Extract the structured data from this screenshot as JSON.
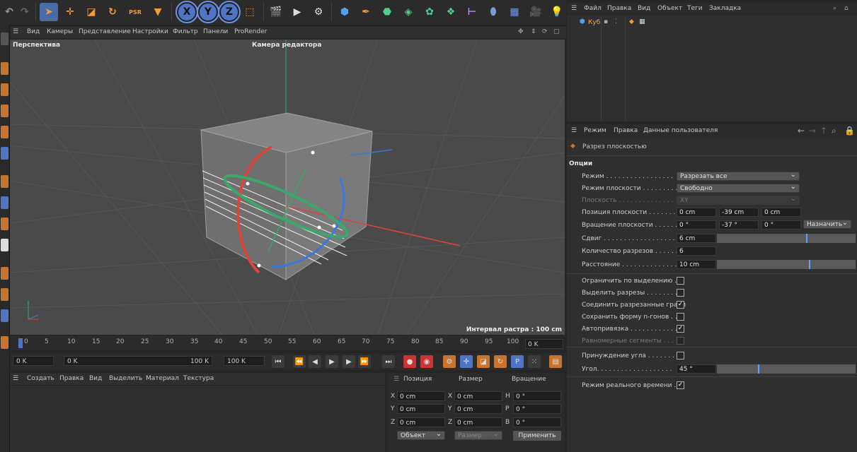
{
  "viewport": {
    "menu": [
      "Вид",
      "Камеры",
      "Представление",
      "Настройки",
      "Фильтр",
      "Панели",
      "ProRender"
    ],
    "title": "Перспектива",
    "camera": "Камера редактора",
    "grid_spacing": "Интервал растра : 100 cm"
  },
  "timeline": {
    "ticks": [
      "0",
      "5",
      "10",
      "15",
      "20",
      "25",
      "30",
      "35",
      "40",
      "45",
      "50",
      "55",
      "60",
      "65",
      "70",
      "75",
      "80",
      "85",
      "90",
      "95",
      "100"
    ],
    "current_frame": "0 K",
    "start": "0 K",
    "range_start": "0 K",
    "range_end": "100 K",
    "end": "100 K"
  },
  "material_menu": [
    "Создать",
    "Правка",
    "Вид",
    "Выделить",
    "Материал",
    "Текстура"
  ],
  "coordinates": {
    "headers": [
      "Позиция",
      "Размер",
      "Вращение"
    ],
    "rows": [
      {
        "axis": "X",
        "pos": "0 cm",
        "saxis": "X",
        "size": "0 cm",
        "raxis": "H",
        "rot": "0 °"
      },
      {
        "axis": "Y",
        "pos": "0 cm",
        "saxis": "Y",
        "size": "0 cm",
        "raxis": "P",
        "rot": "0 °"
      },
      {
        "axis": "Z",
        "pos": "0 cm",
        "saxis": "Z",
        "size": "0 cm",
        "raxis": "B",
        "rot": "0 °"
      }
    ],
    "mode": "Объект",
    "size_mode": "Размер",
    "apply": "Применить"
  },
  "object_menu": [
    "Файл",
    "Правка",
    "Вид",
    "Объект",
    "Теги",
    "Закладка"
  ],
  "objects": [
    {
      "name": "Куб"
    }
  ],
  "attr_menu": [
    "Режим",
    "Правка",
    "Данные пользователя"
  ],
  "attributes": {
    "tool_name": "Разрез плоскостью",
    "section": "Опции",
    "mode_label": "Режим . . . . . . . . . . . . . . . . .",
    "mode_value": "Разрезать все",
    "plane_mode_label": "Режим плоскости . . . . . . . . . .",
    "plane_mode_value": "Свободно",
    "plane_label": "Плоскость . . . . . . . . . . . . . .",
    "plane_value": "XY",
    "plane_pos_label": "Позиция плоскости . . . . . . . . .",
    "plane_pos": [
      "0 cm",
      "-39 cm",
      "0 cm"
    ],
    "plane_rot_label": "Вращение плоскости . . . . . . . .",
    "plane_rot": [
      "0 °",
      "-37 °",
      "0 °"
    ],
    "assign": "Назначить",
    "offset_label": "Сдвиг . . . . . . . . . . . . . . . . . .",
    "offset_value": "6 cm",
    "cuts_label": "Количество разрезов . . . . . . .",
    "cuts_value": "6",
    "distance_label": "Расстояние . . . . . . . . . . . . . .",
    "distance_value": "10 cm",
    "restrict_label": "Ограничить по выделению . .",
    "select_cuts_label": "Выделить разрезы . . . . . . . . .",
    "connect_label": "Соединить разрезанные грани",
    "keep_ngon_label": "Сохранить форму n-гонов . . .",
    "autosnap_label": "Автопривязка . . . . . . . . . . . .",
    "even_label": "Равномерные сегменты . . . . .",
    "angle_constraint_label": "Принуждение угла . . . . . . . .",
    "angle_label": "Угол. . . . . . . . . . . . . . . . . . .",
    "angle_value": "45 °",
    "realtime_label": "Режим реального времени . . ."
  },
  "colors": {
    "accent": "#4f76c6",
    "x_axis": "#d9463a",
    "y_axis": "#3aa86a",
    "z_axis": "#3a78d9"
  }
}
